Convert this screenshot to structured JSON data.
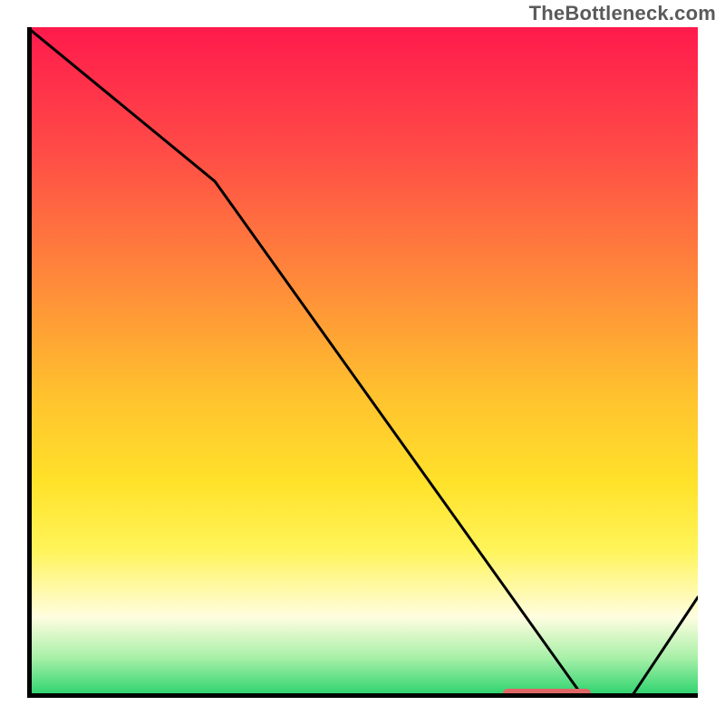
{
  "watermark": "TheBottleneck.com",
  "chart_data": {
    "type": "line",
    "title": "",
    "xlabel": "",
    "ylabel": "",
    "xlim": [
      0,
      100
    ],
    "ylim": [
      0,
      100
    ],
    "x": [
      0,
      28,
      83,
      90,
      100
    ],
    "values": [
      100,
      77,
      0,
      0,
      15
    ],
    "highlight_range_x": [
      71,
      84
    ],
    "colors": {
      "top": "#ff1a4c",
      "mid_high": "#ffc22e",
      "mid_low": "#fff45a",
      "bottom": "#23d16a",
      "marker": "#e06666",
      "line": "#000000"
    }
  }
}
